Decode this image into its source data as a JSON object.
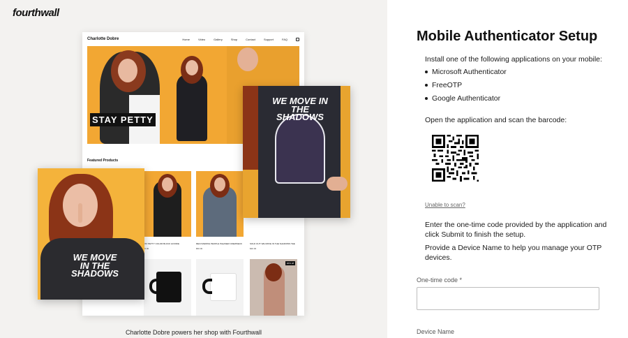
{
  "brand": {
    "logo_text": "fourthwall"
  },
  "showcase": {
    "caption": "Charlotte Dobre powers her shop with Fourthwall",
    "store_name": "Charlotte Dobre",
    "nav_links": [
      "Home",
      "Video",
      "Gallery",
      "Shop",
      "Contact",
      "Support",
      "FAQ"
    ],
    "hero_shirt_text": "STAY PETTY",
    "featured_heading": "Featured Products",
    "products": [
      {
        "name": "STAY PETTY COLOR BLOCK HOODIE",
        "price": "$65.00"
      },
      {
        "name": "RECOVERING PEOPLE PLEASER CREWNECK",
        "price": "$50.00"
      },
      {
        "name": "SOLD OUT: WE MOVE IN THE SHADOWS TEE",
        "price": "$30.00"
      }
    ],
    "mug_badge": "20% off",
    "shirt_text_a": "WE MOVE IN THE SHADOWS",
    "shirt_text_b": "WE MOVE IN THE SHADOWS"
  },
  "setup": {
    "title": "Mobile Authenticator Setup",
    "install_intro": "Install one of the following applications on your mobile:",
    "apps": [
      "Microsoft Authenticator",
      "FreeOTP",
      "Google Authenticator"
    ],
    "scan_instruction": "Open the application and scan the barcode:",
    "unable_link": "Unable to scan?",
    "enter_code_text": "Enter the one-time code provided by the application and click Submit to finish the setup.",
    "device_name_text": "Provide a Device Name to help you manage your OTP devices.",
    "otp_label": "One-time code *",
    "otp_value": "",
    "device_label": "Device Name"
  },
  "colors": {
    "accent_yellow": "#f2a733",
    "text": "#1a1a1a",
    "muted": "#666666"
  }
}
